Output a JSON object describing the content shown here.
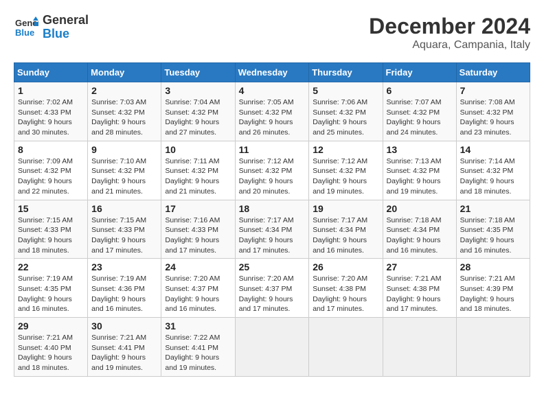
{
  "header": {
    "logo_line1": "General",
    "logo_line2": "Blue",
    "month_title": "December 2024",
    "location": "Aquara, Campania, Italy"
  },
  "weekdays": [
    "Sunday",
    "Monday",
    "Tuesday",
    "Wednesday",
    "Thursday",
    "Friday",
    "Saturday"
  ],
  "weeks": [
    [
      {
        "day": "1",
        "sunrise": "7:02 AM",
        "sunset": "4:33 PM",
        "daylight": "9 hours and 30 minutes."
      },
      {
        "day": "2",
        "sunrise": "7:03 AM",
        "sunset": "4:32 PM",
        "daylight": "9 hours and 28 minutes."
      },
      {
        "day": "3",
        "sunrise": "7:04 AM",
        "sunset": "4:32 PM",
        "daylight": "9 hours and 27 minutes."
      },
      {
        "day": "4",
        "sunrise": "7:05 AM",
        "sunset": "4:32 PM",
        "daylight": "9 hours and 26 minutes."
      },
      {
        "day": "5",
        "sunrise": "7:06 AM",
        "sunset": "4:32 PM",
        "daylight": "9 hours and 25 minutes."
      },
      {
        "day": "6",
        "sunrise": "7:07 AM",
        "sunset": "4:32 PM",
        "daylight": "9 hours and 24 minutes."
      },
      {
        "day": "7",
        "sunrise": "7:08 AM",
        "sunset": "4:32 PM",
        "daylight": "9 hours and 23 minutes."
      }
    ],
    [
      {
        "day": "8",
        "sunrise": "7:09 AM",
        "sunset": "4:32 PM",
        "daylight": "9 hours and 22 minutes."
      },
      {
        "day": "9",
        "sunrise": "7:10 AM",
        "sunset": "4:32 PM",
        "daylight": "9 hours and 21 minutes."
      },
      {
        "day": "10",
        "sunrise": "7:11 AM",
        "sunset": "4:32 PM",
        "daylight": "9 hours and 21 minutes."
      },
      {
        "day": "11",
        "sunrise": "7:12 AM",
        "sunset": "4:32 PM",
        "daylight": "9 hours and 20 minutes."
      },
      {
        "day": "12",
        "sunrise": "7:12 AM",
        "sunset": "4:32 PM",
        "daylight": "9 hours and 19 minutes."
      },
      {
        "day": "13",
        "sunrise": "7:13 AM",
        "sunset": "4:32 PM",
        "daylight": "9 hours and 19 minutes."
      },
      {
        "day": "14",
        "sunrise": "7:14 AM",
        "sunset": "4:32 PM",
        "daylight": "9 hours and 18 minutes."
      }
    ],
    [
      {
        "day": "15",
        "sunrise": "7:15 AM",
        "sunset": "4:33 PM",
        "daylight": "9 hours and 18 minutes."
      },
      {
        "day": "16",
        "sunrise": "7:15 AM",
        "sunset": "4:33 PM",
        "daylight": "9 hours and 17 minutes."
      },
      {
        "day": "17",
        "sunrise": "7:16 AM",
        "sunset": "4:33 PM",
        "daylight": "9 hours and 17 minutes."
      },
      {
        "day": "18",
        "sunrise": "7:17 AM",
        "sunset": "4:34 PM",
        "daylight": "9 hours and 17 minutes."
      },
      {
        "day": "19",
        "sunrise": "7:17 AM",
        "sunset": "4:34 PM",
        "daylight": "9 hours and 16 minutes."
      },
      {
        "day": "20",
        "sunrise": "7:18 AM",
        "sunset": "4:34 PM",
        "daylight": "9 hours and 16 minutes."
      },
      {
        "day": "21",
        "sunrise": "7:18 AM",
        "sunset": "4:35 PM",
        "daylight": "9 hours and 16 minutes."
      }
    ],
    [
      {
        "day": "22",
        "sunrise": "7:19 AM",
        "sunset": "4:35 PM",
        "daylight": "9 hours and 16 minutes."
      },
      {
        "day": "23",
        "sunrise": "7:19 AM",
        "sunset": "4:36 PM",
        "daylight": "9 hours and 16 minutes."
      },
      {
        "day": "24",
        "sunrise": "7:20 AM",
        "sunset": "4:37 PM",
        "daylight": "9 hours and 16 minutes."
      },
      {
        "day": "25",
        "sunrise": "7:20 AM",
        "sunset": "4:37 PM",
        "daylight": "9 hours and 17 minutes."
      },
      {
        "day": "26",
        "sunrise": "7:20 AM",
        "sunset": "4:38 PM",
        "daylight": "9 hours and 17 minutes."
      },
      {
        "day": "27",
        "sunrise": "7:21 AM",
        "sunset": "4:38 PM",
        "daylight": "9 hours and 17 minutes."
      },
      {
        "day": "28",
        "sunrise": "7:21 AM",
        "sunset": "4:39 PM",
        "daylight": "9 hours and 18 minutes."
      }
    ],
    [
      {
        "day": "29",
        "sunrise": "7:21 AM",
        "sunset": "4:40 PM",
        "daylight": "9 hours and 18 minutes."
      },
      {
        "day": "30",
        "sunrise": "7:21 AM",
        "sunset": "4:41 PM",
        "daylight": "9 hours and 19 minutes."
      },
      {
        "day": "31",
        "sunrise": "7:22 AM",
        "sunset": "4:41 PM",
        "daylight": "9 hours and 19 minutes."
      },
      null,
      null,
      null,
      null
    ]
  ],
  "labels": {
    "sunrise": "Sunrise:",
    "sunset": "Sunset:",
    "daylight": "Daylight:"
  }
}
